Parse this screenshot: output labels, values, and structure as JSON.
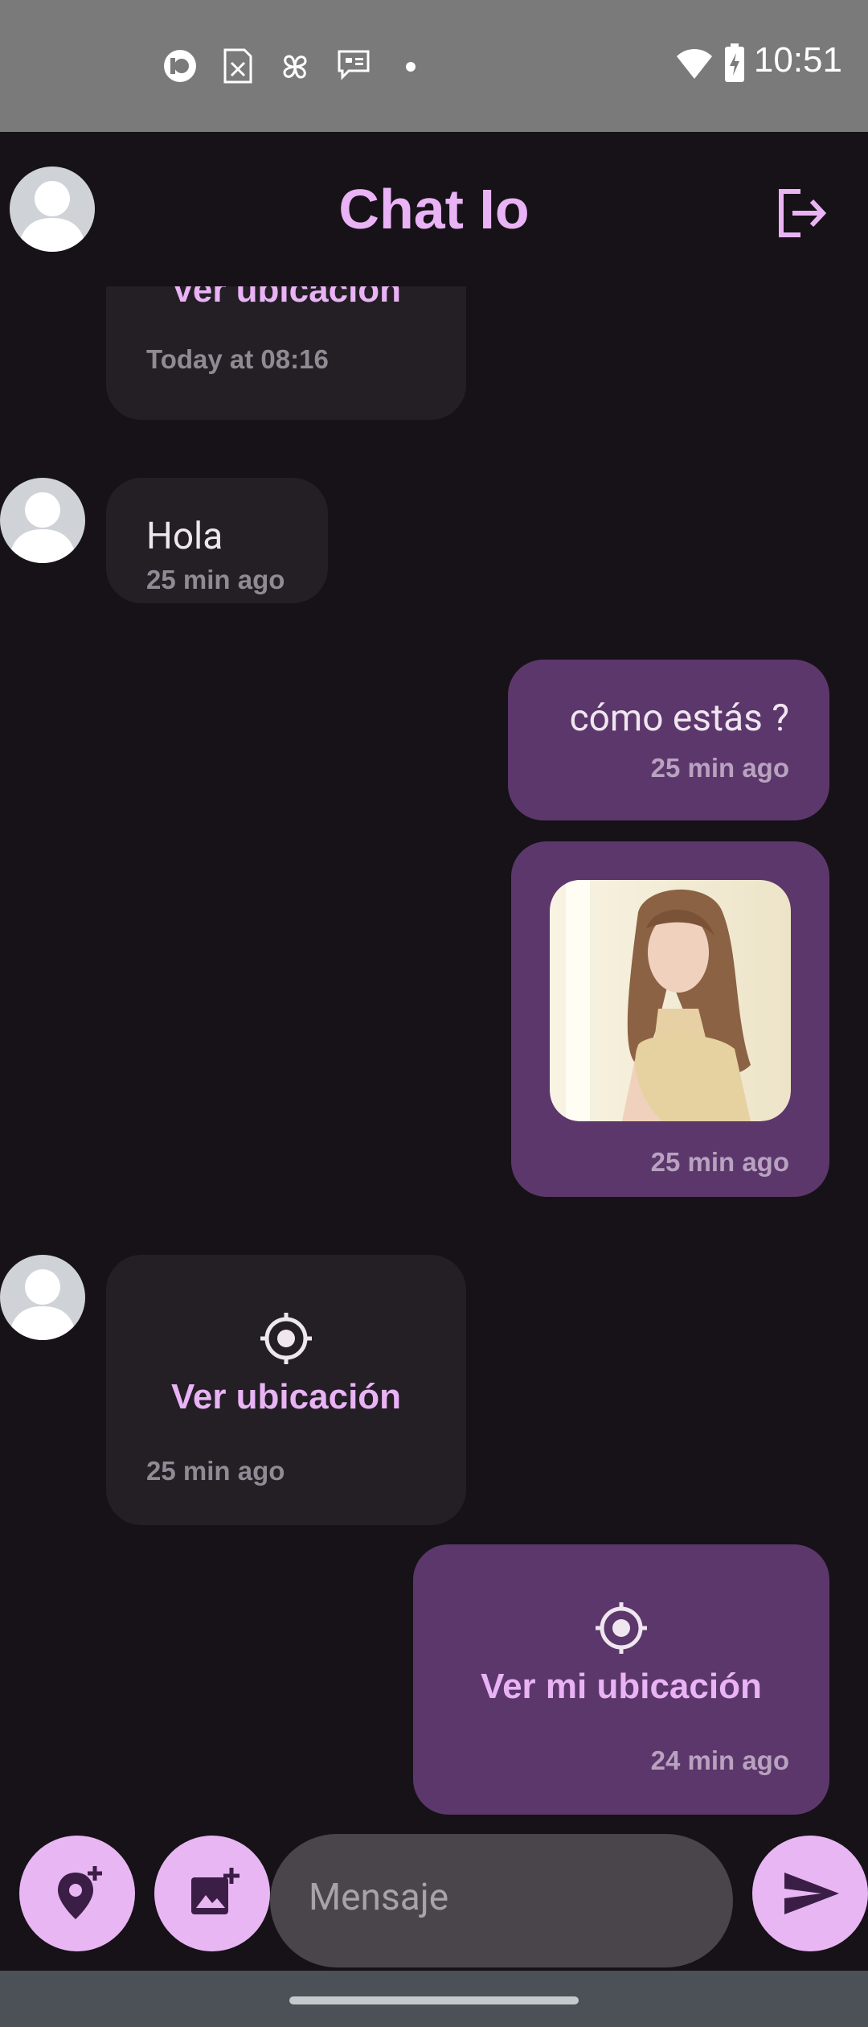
{
  "status_bar": {
    "time": "10:51",
    "left_icons": [
      "pocket-casts-icon",
      "sim-error-icon",
      "pinwheel-icon",
      "message-badge-icon",
      "dot-icon"
    ],
    "right_icons": [
      "wifi-icon",
      "battery-charging-icon"
    ]
  },
  "app_bar": {
    "title": "Chat Io",
    "avatar_icon": "user-avatar-icon",
    "logout_icon": "logout-icon"
  },
  "messages": [
    {
      "side": "in",
      "type": "location",
      "link_label": "Ver ubicación",
      "time": "Today at 08:16"
    },
    {
      "side": "in",
      "type": "text",
      "text": "Hola",
      "time": "25 min ago"
    },
    {
      "side": "out",
      "type": "text",
      "text": "cómo estás ?",
      "time": "25 min ago"
    },
    {
      "side": "out",
      "type": "image",
      "time": "25 min ago"
    },
    {
      "side": "in",
      "type": "location",
      "link_label": "Ver ubicación",
      "time": "25 min ago"
    },
    {
      "side": "out",
      "type": "location",
      "link_label": "Ver mi ubicación",
      "time": "24 min ago"
    }
  ],
  "composer": {
    "placeholder": "Mensaje",
    "add_location_icon": "add-location-icon",
    "add_photo_icon": "add-photo-icon",
    "send_icon": "send-icon"
  },
  "colors": {
    "background": "#161218",
    "accent": "#e8b6f3",
    "incoming_bubble": "#231f25",
    "outgoing_bubble": "#5c376b"
  }
}
